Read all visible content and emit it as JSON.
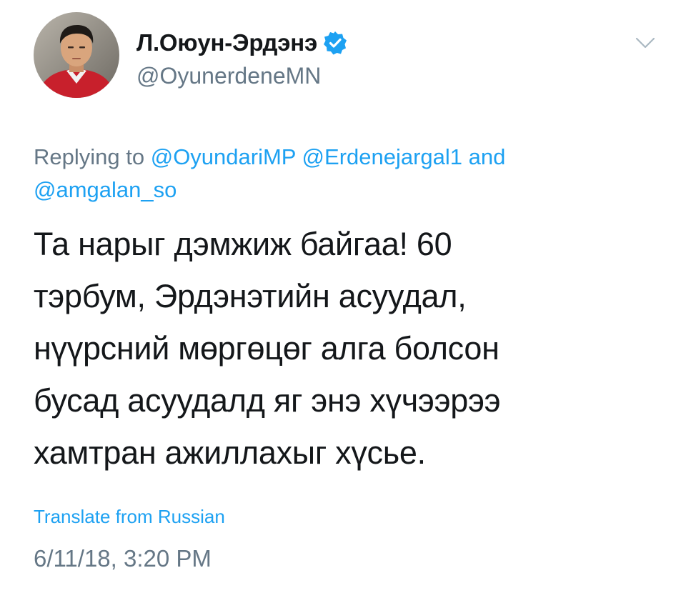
{
  "author": {
    "display_name": "Л.Оюун-Эрдэнэ",
    "handle": "@OyunerdeneMN",
    "verified": true,
    "avatar_icon": "profile-photo"
  },
  "menu": {
    "icon": "chevron-down-icon"
  },
  "reply": {
    "prefix": "Replying to",
    "mentions": [
      "@OyundariMP",
      "@Erdenejargal1",
      "@amgalan_so"
    ],
    "conjunction": "and"
  },
  "tweet": {
    "lines": [
      "Та нарыг дэмжиж байгаа! 60",
      "тэрбум, Эрдэнэтийн асуудал,",
      "нүүрсний мөргөцөг алга болсон",
      "бусад асуудалд яг энэ хүчээрээ",
      "хамтран ажиллахыг хүсье."
    ]
  },
  "translate_label": "Translate from Russian",
  "timestamp": "6/11/18, 3:20 PM",
  "colors": {
    "link": "#1da1f2",
    "secondary": "#657786",
    "primary": "#14171a",
    "verified_badge": "#1da1f2"
  }
}
